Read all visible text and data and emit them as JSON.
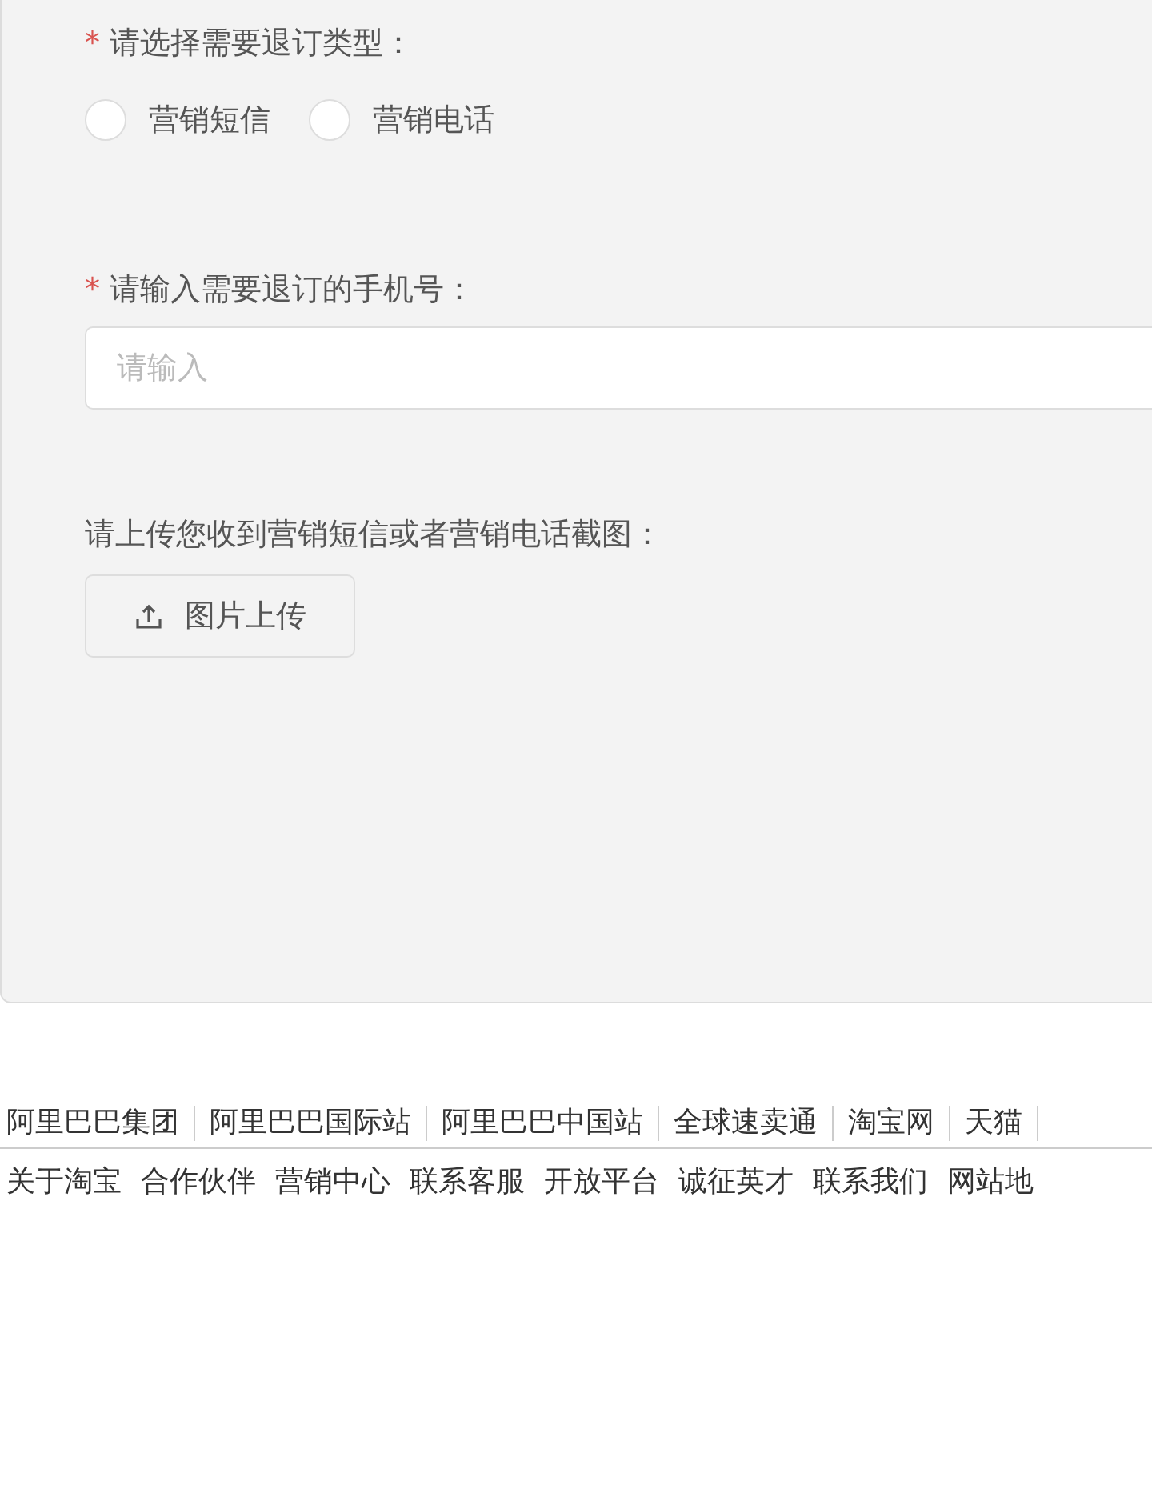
{
  "form": {
    "type_label": {
      "required_mark": "*",
      "text": "请选择需要退订类型："
    },
    "type_options": [
      {
        "label": "营销短信",
        "selected": false
      },
      {
        "label": "营销电话",
        "selected": false
      }
    ],
    "phone_label": {
      "required_mark": "*",
      "text": "请输入需要退订的手机号："
    },
    "phone_field": {
      "placeholder": "请输入"
    },
    "upload_label": {
      "text": "请上传您收到营销短信或者营销电话截图："
    },
    "upload_button": "图片上传"
  },
  "footer": {
    "group_links": [
      "阿里巴巴集团",
      "阿里巴巴国际站",
      "阿里巴巴中国站",
      "全球速卖通",
      "淘宝网",
      "天猫"
    ],
    "site_links": [
      "关于淘宝",
      "合作伙伴",
      "营销中心",
      "联系客服",
      "开放平台",
      "诚征英才",
      "联系我们",
      "网站地"
    ]
  }
}
